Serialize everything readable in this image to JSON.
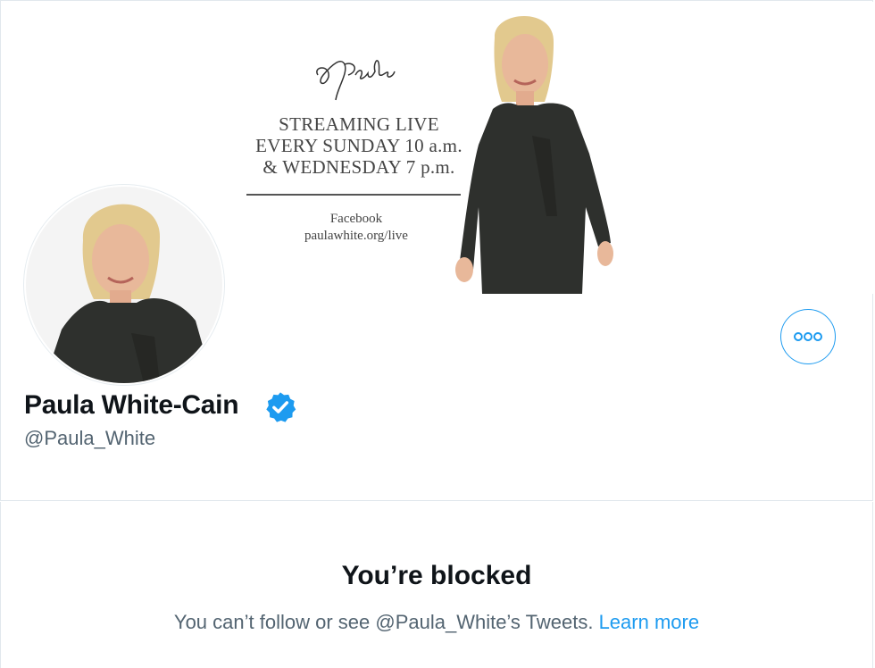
{
  "profile": {
    "display_name": "Paula White-Cain",
    "handle": "@Paula_White",
    "verified": true
  },
  "banner": {
    "signature_text": "Paula",
    "lines": [
      "STREAMING LIVE",
      "EVERY SUNDAY 10 a.m.",
      "& WEDNESDAY 7 p.m."
    ],
    "platform": "Facebook",
    "url": "paulawhite.org/live"
  },
  "actions": {
    "more_icon": "more-horizontal-icon"
  },
  "blocked": {
    "title": "You’re blocked",
    "message_prefix": "You can’t follow or see @Paula_White’s Tweets. ",
    "learn_more": "Learn more"
  },
  "colors": {
    "accent": "#1d9bf0",
    "muted_text": "#536471",
    "border": "#e1e8ed"
  }
}
